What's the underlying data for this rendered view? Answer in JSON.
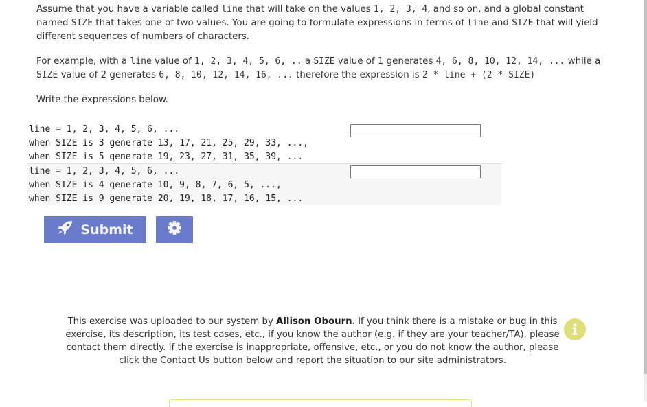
{
  "instructions": {
    "p1": {
      "t1": "Assume that you have a variable called ",
      "code1": "line",
      "t2": " that will take on the values ",
      "code2": "1, 2, 3, 4",
      "t3": ", and so on, and a global constant named ",
      "code3": "SIZE",
      "t4": " that takes one of two values. You are going to formulate expressions in terms of ",
      "code4": "line",
      "t5": " and ",
      "code5": "SIZE",
      "t6": " that will yield different sequences of numbers of characters."
    },
    "p2": {
      "t1": "For example, with a ",
      "code1": "line",
      "t2": " value of ",
      "code2": "1, 2, 3, 4, 5, 6, ..",
      "t3": " a ",
      "code3": "SIZE",
      "t4": " value of 1 generates ",
      "code4": "4, 6, 8, 10, 12, 14, ...",
      "t5": " while a ",
      "code5": "SIZE",
      "t6": " value of 2 generates ",
      "code6": "6, 8, 10, 12, 14, 16, ...",
      "t7": " therefore the expression is ",
      "code7": "2 * line + (2 * SIZE)"
    },
    "p3": "Write the expressions below."
  },
  "problems": [
    {
      "lines": [
        "line = 1, 2, 3, 4, 5, 6, ...",
        "when SIZE is 3 generate 13, 17, 21, 25, 29, 33, ...,",
        "when SIZE is 5 generate 19, 23, 27, 31, 35, 39, ..."
      ],
      "answer": ""
    },
    {
      "lines": [
        "line = 1, 2, 3, 4, 5, 6, ...",
        "when SIZE is 4 generate 10, 9, 8, 7, 6, 5, ...,",
        "when SIZE is 9 generate 20, 19, 18, 17, 16, 15, ..."
      ],
      "answer": ""
    }
  ],
  "actions": {
    "submit_label": "Submit",
    "submit_icon": "rocket-icon",
    "settings_icon": "gear-icon",
    "button_color": "#6a7bcc"
  },
  "footer": {
    "t1": "This exercise was uploaded to our system by ",
    "author": "Allison Obourn",
    "t2": ". If you think there is a mistake or bug in this exercise, its description, its test cases, etc., if you know the author (e.g. if they are your teacher/TA), please contact them directly. If the exercise is inappropriate, offensive, etc., or you do not know the author, please click the Contact Us button below and report the situation to our site administrators.",
    "info_icon": "info-icon",
    "info_color": "#dede7a"
  }
}
